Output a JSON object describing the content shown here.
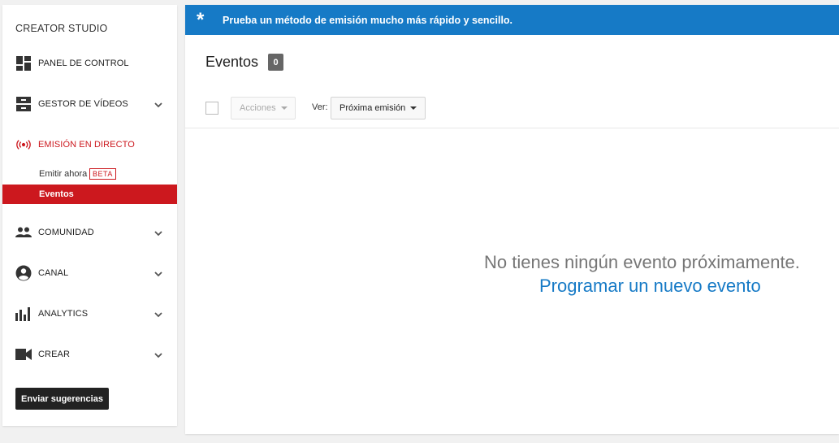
{
  "sidebar": {
    "title": "CREATOR STUDIO",
    "items": [
      {
        "label": "PANEL DE CONTROL",
        "icon": "dashboard-icon"
      },
      {
        "label": "GESTOR DE VÍDEOS",
        "icon": "video-manager-icon"
      },
      {
        "label": "EMISIÓN EN DIRECTO",
        "icon": "live-broadcast-icon"
      },
      {
        "label": "COMUNIDAD",
        "icon": "community-icon"
      },
      {
        "label": "CANAL",
        "icon": "channel-icon"
      },
      {
        "label": "ANALYTICS",
        "icon": "analytics-icon"
      },
      {
        "label": "CREAR",
        "icon": "create-icon"
      }
    ],
    "live_sub": {
      "stream_now": "Emitir ahora",
      "beta": "BETA",
      "events": "Eventos"
    },
    "feedback_button": "Enviar sugerencias"
  },
  "banner": {
    "star": "*",
    "message": "Prueba un método de emisión mucho más rápido y sencillo."
  },
  "main": {
    "title": "Eventos",
    "count": "0",
    "actions_label": "Acciones",
    "view_label": "Ver:",
    "view_selected": "Próxima emisión",
    "empty_message": "No tienes ningún evento próximamente.",
    "new_event_link": "Programar un nuevo evento"
  },
  "colors": {
    "accent_red": "#cc181e",
    "banner_blue": "#167ac6",
    "link_blue": "#167ac6"
  }
}
